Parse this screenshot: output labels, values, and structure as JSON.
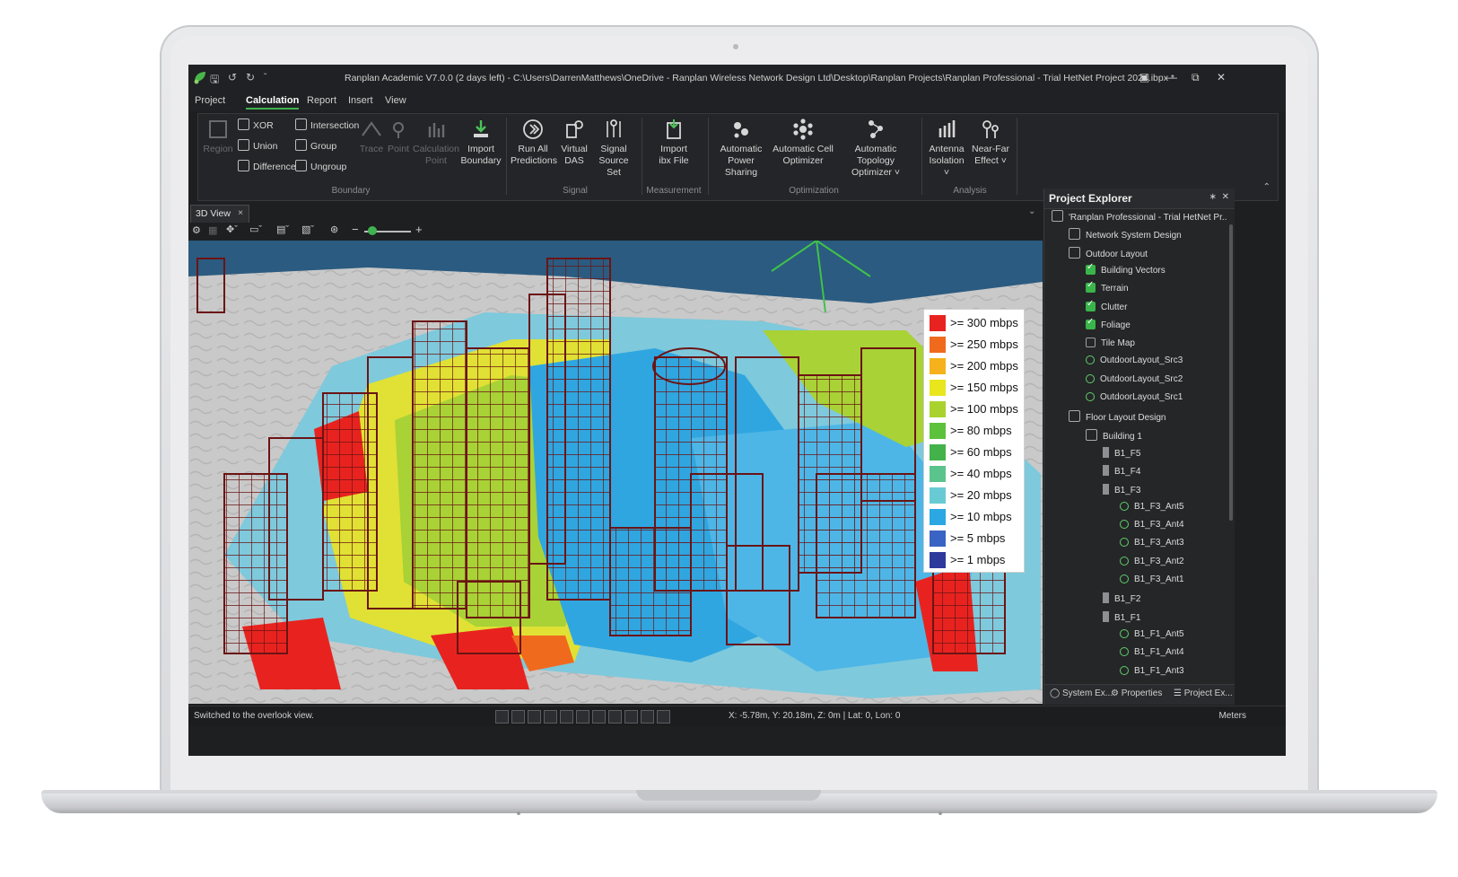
{
  "window": {
    "title": "Ranplan Academic V7.0.0 (2 days left) - C:\\Users\\DarrenMatthews\\OneDrive - Ranplan Wireless Network Design Ltd\\Desktop\\Ranplan Projects\\Ranplan Professional - Trial HetNet Project 2024.ibpx *"
  },
  "menu": [
    "Project",
    "Calculation",
    "Report",
    "Insert",
    "View"
  ],
  "menu_active": "Calculation",
  "ribbon": {
    "boundary": {
      "region": "Region",
      "xor": "XOR",
      "union": "Union",
      "difference": "Difference",
      "intersection": "Intersection",
      "group": "Group",
      "ungroup": "Ungroup",
      "trace": "Trace",
      "point": "Point",
      "calc_point_1": "Calculation",
      "calc_point_2": "Point",
      "import_1": "Import",
      "import_2": "Boundary",
      "group_label": "Boundary"
    },
    "signal": {
      "run_1": "Run All",
      "run_2": "Predictions",
      "vdas_1": "Virtual",
      "vdas_2": "DAS",
      "sset_1": "Signal",
      "sset_2": "Source Set",
      "group_label": "Signal"
    },
    "measurement": {
      "imp_1": "Import",
      "imp_2": "ibx File",
      "group_label": "Measurement"
    },
    "optimization": {
      "aps_1": "Automatic",
      "aps_2": "Power Sharing",
      "aco_1": "Automatic Cell",
      "aco_2": "Optimizer",
      "ato_1": "Automatic Topology",
      "ato_2": "Optimizer ˅",
      "group_label": "Optimization"
    },
    "analysis": {
      "ai_1": "Antenna",
      "ai_2": "Isolation ˅",
      "nf_1": "Near-Far",
      "nf_2": "Effect ˅",
      "group_label": "Analysis"
    }
  },
  "view_tab": {
    "label": "3D View",
    "close": "×"
  },
  "legend": [
    {
      "label": ">= 300 mbps",
      "color": "#e8231f"
    },
    {
      "label": ">= 250 mbps",
      "color": "#f06a1e"
    },
    {
      "label": ">= 200 mbps",
      "color": "#f5b21c"
    },
    {
      "label": ">= 150 mbps",
      "color": "#e9e61e"
    },
    {
      "label": ">= 100 mbps",
      "color": "#a9d22e"
    },
    {
      "label": ">= 80 mbps",
      "color": "#5cc23c"
    },
    {
      "label": ">= 60 mbps",
      "color": "#43b24a"
    },
    {
      "label": ">= 40 mbps",
      "color": "#5bc48d"
    },
    {
      "label": ">= 20 mbps",
      "color": "#68cbd3"
    },
    {
      "label": ">= 10 mbps",
      "color": "#2ba7e3"
    },
    {
      "label": ">= 5 mbps",
      "color": "#3a64c3"
    },
    {
      "label": ">= 1 mbps",
      "color": "#2d3a9c"
    }
  ],
  "explorer": {
    "title": "Project Explorer",
    "tree": [
      {
        "label": "'Ranplan Professional - Trial HetNet Pr...",
        "indent": 0,
        "icon": "project-icon"
      },
      {
        "label": "Network System Design",
        "indent": 1,
        "icon": "network-icon"
      },
      {
        "label": "Outdoor Layout",
        "indent": 1,
        "icon": "building-icon"
      },
      {
        "label": "Building Vectors",
        "indent": 2,
        "icon": "checkbox-checked-icon"
      },
      {
        "label": "Terrain",
        "indent": 2,
        "icon": "checkbox-checked-icon"
      },
      {
        "label": "Clutter",
        "indent": 2,
        "icon": "checkbox-checked-icon"
      },
      {
        "label": "Foliage",
        "indent": 2,
        "icon": "checkbox-checked-icon"
      },
      {
        "label": "Tile Map",
        "indent": 2,
        "icon": "checkbox-unchecked-icon"
      },
      {
        "label": "OutdoorLayout_Src3",
        "indent": 2,
        "icon": "antenna-icon"
      },
      {
        "label": "OutdoorLayout_Src2",
        "indent": 2,
        "icon": "antenna-icon"
      },
      {
        "label": "OutdoorLayout_Src1",
        "indent": 2,
        "icon": "antenna-icon"
      },
      {
        "label": "Floor Layout Design",
        "indent": 1,
        "icon": "floor-layout-icon"
      },
      {
        "label": "Building 1",
        "indent": 2,
        "icon": "building-hex-icon"
      },
      {
        "label": "B1_F5",
        "indent": 3,
        "icon": "floor-icon"
      },
      {
        "label": "B1_F4",
        "indent": 3,
        "icon": "floor-icon"
      },
      {
        "label": "B1_F3",
        "indent": 3,
        "icon": "floor-icon"
      },
      {
        "label": "B1_F3_Ant5",
        "indent": 4,
        "icon": "antenna-icon"
      },
      {
        "label": "B1_F3_Ant4",
        "indent": 4,
        "icon": "antenna-icon"
      },
      {
        "label": "B1_F3_Ant3",
        "indent": 4,
        "icon": "antenna-icon"
      },
      {
        "label": "B1_F3_Ant2",
        "indent": 4,
        "icon": "antenna-icon"
      },
      {
        "label": "B1_F3_Ant1",
        "indent": 4,
        "icon": "antenna-icon"
      },
      {
        "label": "B1_F2",
        "indent": 3,
        "icon": "floor-icon"
      },
      {
        "label": "B1_F1",
        "indent": 3,
        "icon": "floor-icon"
      },
      {
        "label": "B1_F1_Ant5",
        "indent": 4,
        "icon": "antenna-icon"
      },
      {
        "label": "B1_F1_Ant4",
        "indent": 4,
        "icon": "antenna-icon"
      },
      {
        "label": "B1_F1_Ant3",
        "indent": 4,
        "icon": "antenna-icon"
      }
    ],
    "tabs": [
      "System Ex...",
      "Properties",
      "Project Ex..."
    ]
  },
  "status": {
    "message": "Switched to the overlook view.",
    "coords": "X: -5.78m, Y: 20.18m, Z: 0m | Lat: 0, Lon: 0",
    "units": "Meters"
  }
}
